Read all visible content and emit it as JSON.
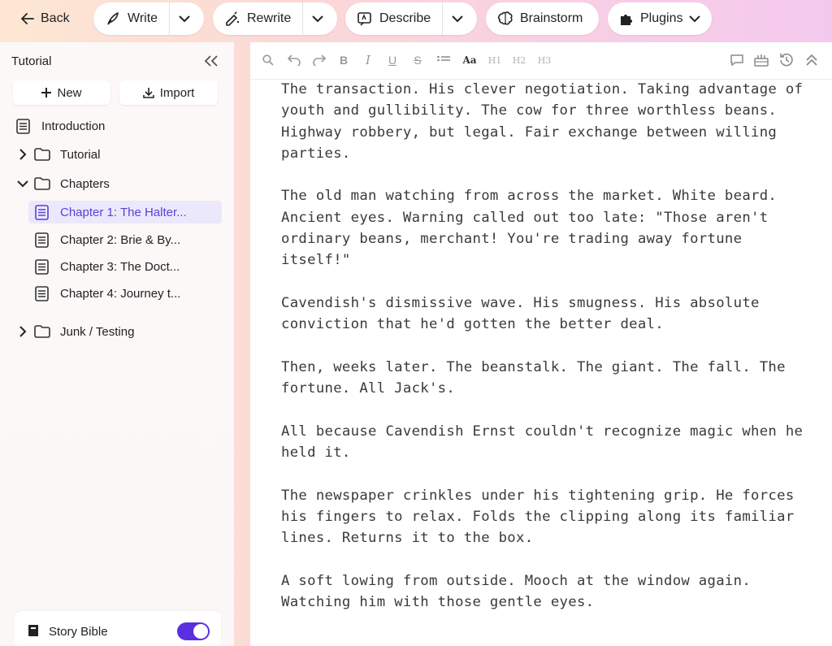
{
  "topbar": {
    "back_label": "Back",
    "write_label": "Write",
    "rewrite_label": "Rewrite",
    "describe_label": "Describe",
    "brainstorm_label": "Brainstorm",
    "plugins_label": "Plugins"
  },
  "sidebar": {
    "title": "Tutorial",
    "new_label": "New",
    "import_label": "Import",
    "items": [
      {
        "label": "Introduction",
        "type": "doc"
      },
      {
        "label": "Tutorial",
        "type": "folder",
        "expanded": false
      },
      {
        "label": "Chapters",
        "type": "folder",
        "expanded": true
      },
      {
        "label": "Chapter 1: The Halter...",
        "type": "doc",
        "active": true
      },
      {
        "label": "Chapter 2: Brie & By...",
        "type": "doc"
      },
      {
        "label": "Chapter 3: The Doct...",
        "type": "doc"
      },
      {
        "label": "Chapter 4: Journey t...",
        "type": "doc"
      },
      {
        "label": "Junk / Testing",
        "type": "folder",
        "expanded": false
      }
    ],
    "story_bible_label": "Story Bible",
    "story_bible_enabled": true
  },
  "editor": {
    "toolbar": {
      "h1": "H1",
      "h2": "H2",
      "h3": "H3",
      "aa": "Aa",
      "bold": "B",
      "italic": "I",
      "underline": "U",
      "strike": "S"
    },
    "paragraphs": [
      "The transaction. His clever negotiation. Taking advantage of youth and gullibility. The cow for three worthless beans. Highway robbery, but legal. Fair exchange between willing parties.",
      "The old man watching from across the market. White beard. Ancient eyes. Warning called out too late: \"Those aren't ordinary beans, merchant! You're trading away fortune itself!\"",
      "Cavendish's dismissive wave. His smugness. His absolute conviction that he'd gotten the better deal.",
      "Then, weeks later. The beanstalk. The giant. The fall. The fortune. All Jack's.",
      "All because Cavendish Ernst couldn't recognize magic when he held it.",
      "The newspaper crinkles under his tightening grip. He forces his fingers to relax. Folds the clipping along its familiar lines. Returns it to the box.",
      "A soft lowing from outside. Mooch at the window again. Watching him with those gentle eyes."
    ]
  },
  "colors": {
    "accent": "#5b2fe0",
    "active_bg": "#ece8fb",
    "active_text": "#5b3fd6"
  }
}
